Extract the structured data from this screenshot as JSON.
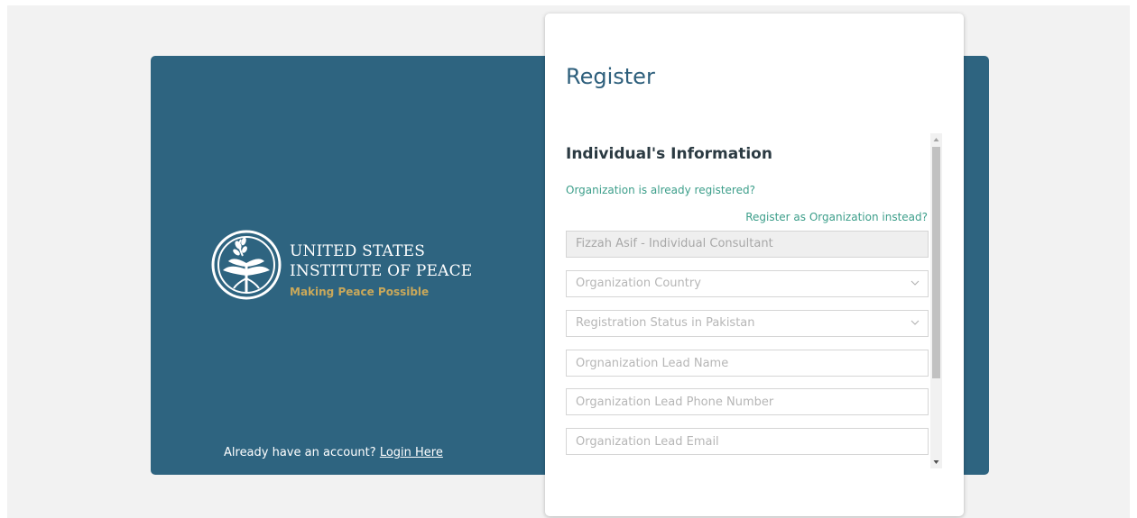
{
  "brand": {
    "line1": "UNITED STATES",
    "line2": "INSTITUTE OF PEACE",
    "tagline": "Making Peace Possible",
    "primary_color": "#2e6480",
    "accent_color": "#c9a85a",
    "emblem_icon": "dove-olive-branch-icon"
  },
  "login": {
    "prompt": "Already have an account?",
    "link_label": "Login Here"
  },
  "form": {
    "title": "Register",
    "section_title": "Individual's Information",
    "org_registered_link": "Organization is already registered?",
    "register_org_link": "Register as Organization instead?",
    "link_color": "#3c9e8a",
    "fields": {
      "individual_name": "Fizzah Asif - Individual Consultant",
      "organization_country_placeholder": "Organization Country",
      "registration_status_placeholder": "Registration Status in Pakistan",
      "lead_name_placeholder": "Orgnanization Lead Name",
      "lead_phone_placeholder": "Organization Lead Phone Number",
      "lead_email_placeholder": "Organization Lead Email"
    }
  }
}
